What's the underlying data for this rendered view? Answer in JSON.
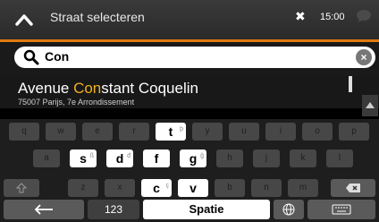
{
  "topbar": {
    "title": "Straat selecteren",
    "time": "15:00"
  },
  "search": {
    "value": "Con"
  },
  "result": {
    "name_before": "Avenue ",
    "name_highlight": "Con",
    "name_after": "stant Coquelin",
    "address": "75007 Parijs, 7e Arrondissement"
  },
  "keyboard": {
    "row1": [
      {
        "k": "q",
        "state": "dim"
      },
      {
        "k": "w",
        "state": "dim"
      },
      {
        "k": "e",
        "state": "dim"
      },
      {
        "k": "r",
        "state": "dim"
      },
      {
        "k": "t",
        "state": "active",
        "alt": "þ"
      },
      {
        "k": "y",
        "state": "dim"
      },
      {
        "k": "u",
        "state": "dim"
      },
      {
        "k": "i",
        "state": "dim"
      },
      {
        "k": "o",
        "state": "dim"
      },
      {
        "k": "p",
        "state": "dim"
      }
    ],
    "row2": [
      {
        "k": "a",
        "state": "dim"
      },
      {
        "k": "s",
        "state": "active",
        "alt": "ß"
      },
      {
        "k": "d",
        "state": "active",
        "alt": "đ"
      },
      {
        "k": "f",
        "state": "active",
        "alt": ""
      },
      {
        "k": "g",
        "state": "active",
        "alt": "ğ"
      },
      {
        "k": "h",
        "state": "dim"
      },
      {
        "k": "j",
        "state": "dim"
      },
      {
        "k": "k",
        "state": "dim"
      },
      {
        "k": "l",
        "state": "dim"
      }
    ],
    "row3": [
      {
        "k": "z",
        "state": "dim"
      },
      {
        "k": "x",
        "state": "dim"
      },
      {
        "k": "c",
        "state": "active",
        "alt": "ç"
      },
      {
        "k": "v",
        "state": "active",
        "alt": ""
      },
      {
        "k": "b",
        "state": "dim"
      },
      {
        "k": "n",
        "state": "dim"
      },
      {
        "k": "m",
        "state": "dim"
      }
    ],
    "numbers_label": "123",
    "space_label": "Spatie"
  }
}
